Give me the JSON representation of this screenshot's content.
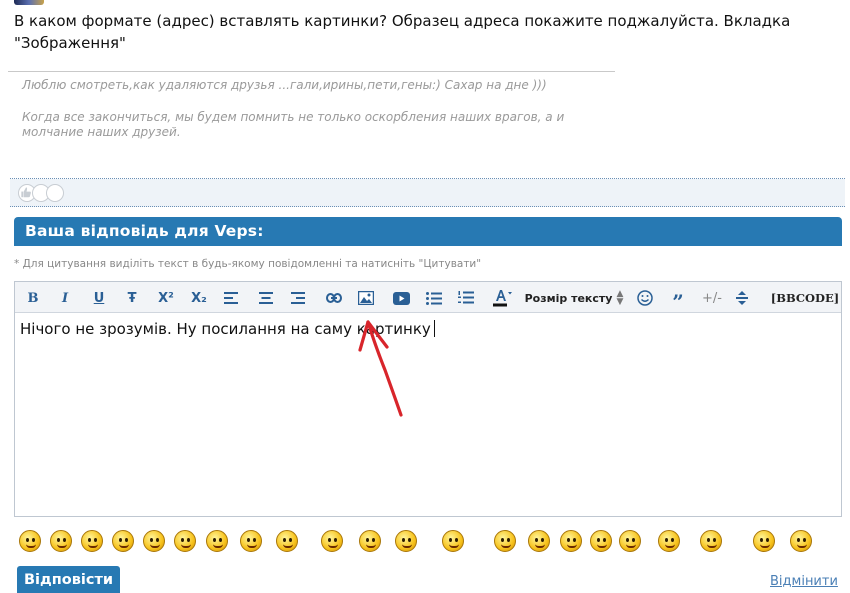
{
  "post": {
    "text": "В каком формате (адрес) вставлять картинки? Образец адреса покажите поджалуйста. Вкладка \"Зображення\"",
    "signature_line1": "Люблю смотреть,как удаляются друзья ...гали,ирины,пети,гены:) Сахар на дне )))",
    "signature_line2": "Когда все закончиться, мы будем помнить не только оскорбления наших врагов, а и молчание наших друзей."
  },
  "reply": {
    "header": "Ваша відповідь для Veps:",
    "hint": "* Для цитування виділіть текст в будь-якому повідомленні та натисніть \"Цитувати\"",
    "editor_text": "Нічого не зрозумів. Ну посилання на саму картинку"
  },
  "toolbar": {
    "bold": "B",
    "italic": "I",
    "underline": "U",
    "strike": "Ŧ",
    "superscript": "X²",
    "subscript": "X₂",
    "size_label": "Розмір тексту",
    "quote": "”",
    "plusminus": "+/-",
    "bbcode": "[BBCODE]"
  },
  "buttons": {
    "reply": "Відповісти",
    "cancel": "Відмінити"
  },
  "colors": {
    "accent": "#2779b3",
    "link": "#4a7fb5",
    "annotation": "#d8252b"
  }
}
